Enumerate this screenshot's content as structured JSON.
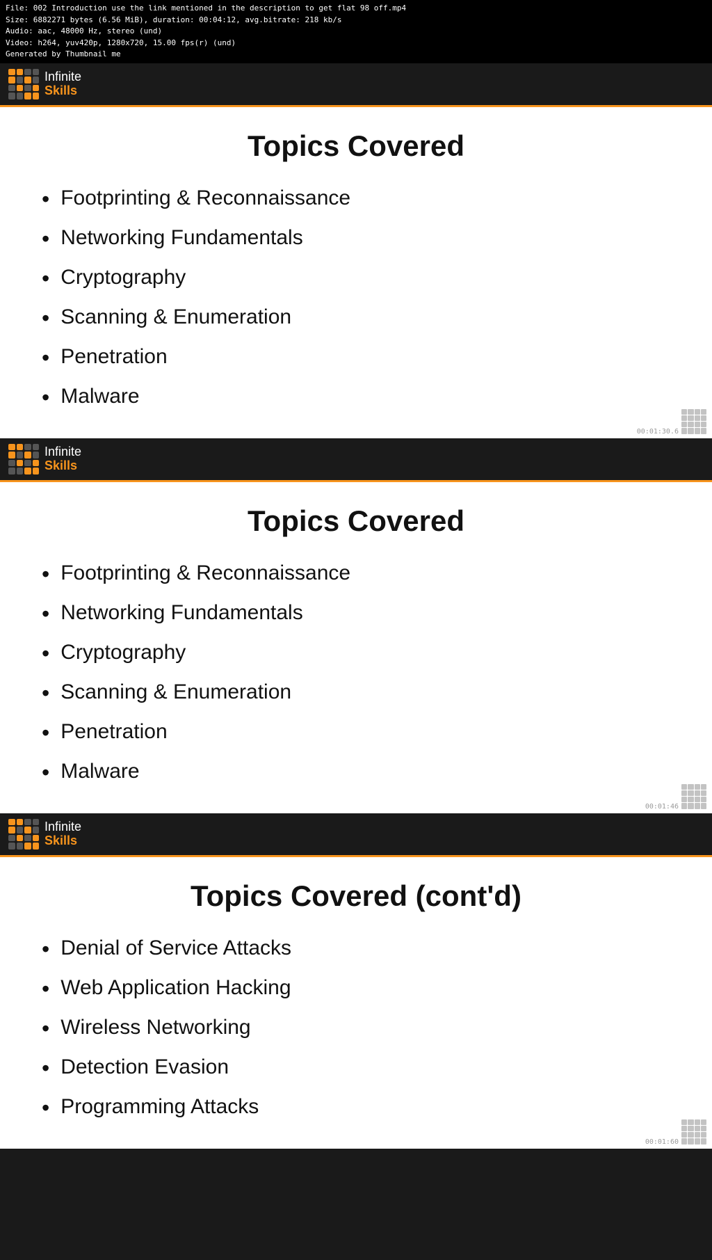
{
  "fileinfo": {
    "line1": "File: 002 Introduction use the link mentioned in the description to get flat 98 off.mp4",
    "line2": "Size: 6882271 bytes (6.56 MiB), duration: 00:04:12, avg.bitrate: 218 kb/s",
    "line3": "Audio: aac, 48000 Hz, stereo (und)",
    "line4": "Video: h264, yuv420p, 1280x720, 15.00 fps(r) (und)",
    "line5": "Generated by Thumbnail me"
  },
  "logo": {
    "infinite": "Infinite",
    "skills": "Skills"
  },
  "slide1": {
    "title": "Topics Covered",
    "items": [
      "Footprinting & Reconnaissance",
      "Networking Fundamentals",
      "Cryptography",
      "Scanning & Enumeration",
      "Penetration",
      "Malware"
    ],
    "timestamp": "00:01:30.6"
  },
  "slide2": {
    "title": "Topics Covered",
    "items": [
      "Footprinting & Reconnaissance",
      "Networking Fundamentals",
      "Cryptography",
      "Scanning & Enumeration",
      "Penetration",
      "Malware"
    ],
    "timestamp": "00:01:46"
  },
  "slide3": {
    "title": "Topics Covered (cont'd)",
    "items": [
      "Denial of Service Attacks",
      "Web Application Hacking",
      "Wireless Networking",
      "Detection Evasion",
      "Programming Attacks"
    ],
    "timestamp": "00:01:60"
  }
}
